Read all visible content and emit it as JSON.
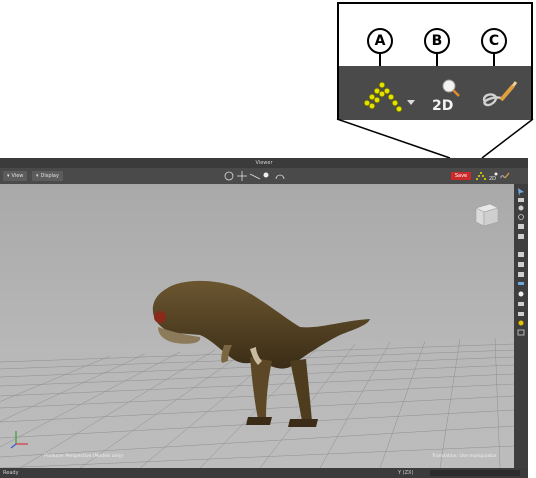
{
  "callout": {
    "labels": [
      "A",
      "B",
      "C"
    ],
    "icons": [
      "point-cloud-icon",
      "2d-pan-zoom-icon",
      "sketch-pen-icon"
    ]
  },
  "viewer": {
    "title": "Viewer",
    "view_menu": "View",
    "display_menu": "Display",
    "save_label": "Save",
    "camera_label": "Producer Perspective (Models only)",
    "manipulator_label": "Translation: Use manipulator",
    "status": "Ready",
    "status_right": "Y (ZX)"
  },
  "colors": {
    "accent_red": "#cc2a2a",
    "icon_yellow": "#e6e200",
    "toolbar": "#4a4a4a"
  }
}
